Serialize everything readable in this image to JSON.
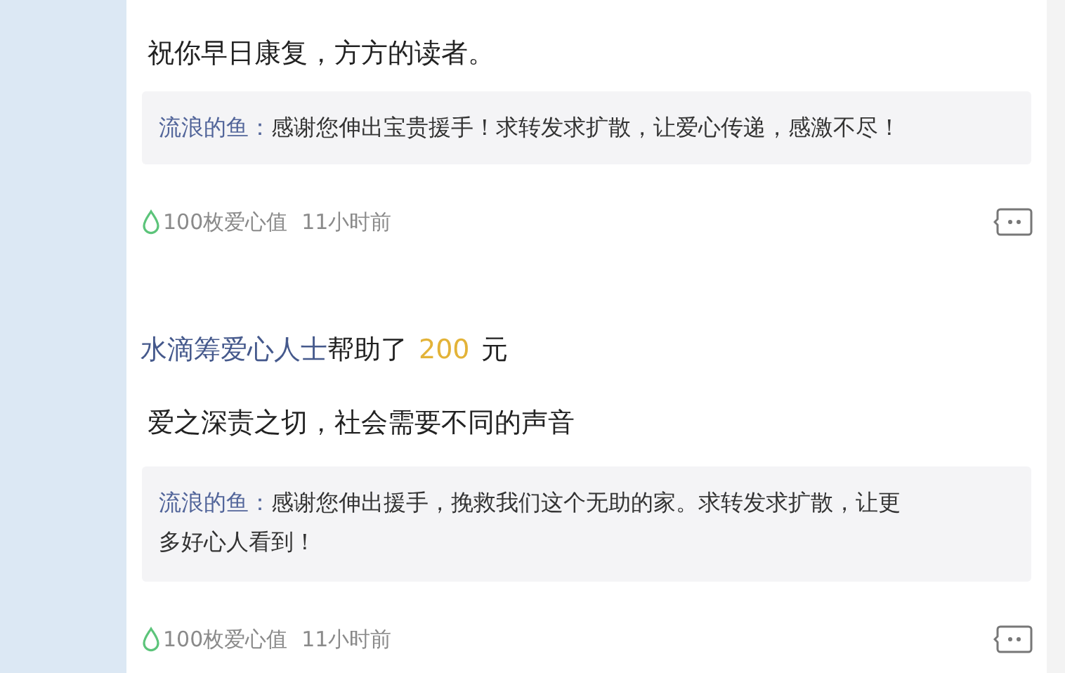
{
  "posts": [
    {
      "message": "祝你早日康复，方方的读者。",
      "reply": {
        "author": "流浪的鱼：",
        "text": "感谢您伸出宝贵援手！求转发求扩散，让爱心传递，感激不尽！"
      },
      "love_value": "100枚爱心值",
      "time": "11小时前"
    },
    {
      "donor": "水滴筹爱心人士",
      "action": "帮助了",
      "amount": "200",
      "unit": "元",
      "message": "爱之深责之切，社会需要不同的声音",
      "reply": {
        "author": "流浪的鱼：",
        "text": "感谢您伸出援手，挽救我们这个无助的家。求转发求扩散，让更多好心人看到！"
      },
      "love_value": "100枚爱心值",
      "time": "11小时前"
    }
  ]
}
